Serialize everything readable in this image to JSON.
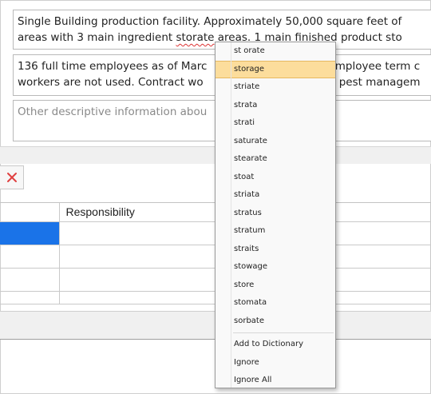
{
  "description_fields": [
    {
      "lines": [
        "Single Building production facility.  Approximately 50,000 square feet of",
        "areas with 3 main ingredient storate areas.  1 main finished product sto"
      ],
      "misspelled_word": "storate"
    },
    {
      "lines": [
        "136 full time employees as of Marc",
        "workers are not used.  Contract wo"
      ],
      "lines_right": [
        "employee term c",
        "or pest managem"
      ]
    },
    {
      "placeholder": "Other descriptive information abou"
    }
  ],
  "delete_button": {
    "icon": "close-icon",
    "color": "#e04040"
  },
  "grid": {
    "headers": [
      "",
      "Responsibility"
    ],
    "rows": [
      {
        "selected": true
      },
      {
        "selected": false
      },
      {
        "selected": false
      },
      {
        "selected": false
      }
    ],
    "selection_color": "#1a73e8"
  },
  "spell_menu": {
    "suggestions": [
      "st orate",
      "storage",
      "striate",
      "strata",
      "strati",
      "saturate",
      "stearate",
      "stoat",
      "striata",
      "stratus",
      "stratum",
      "straits",
      "stowage",
      "store",
      "stomata",
      "sorbate"
    ],
    "highlighted": "storage",
    "actions": [
      "Add to Dictionary",
      "Ignore",
      "Ignore All"
    ],
    "highlight_color": "#fcdd9c"
  }
}
